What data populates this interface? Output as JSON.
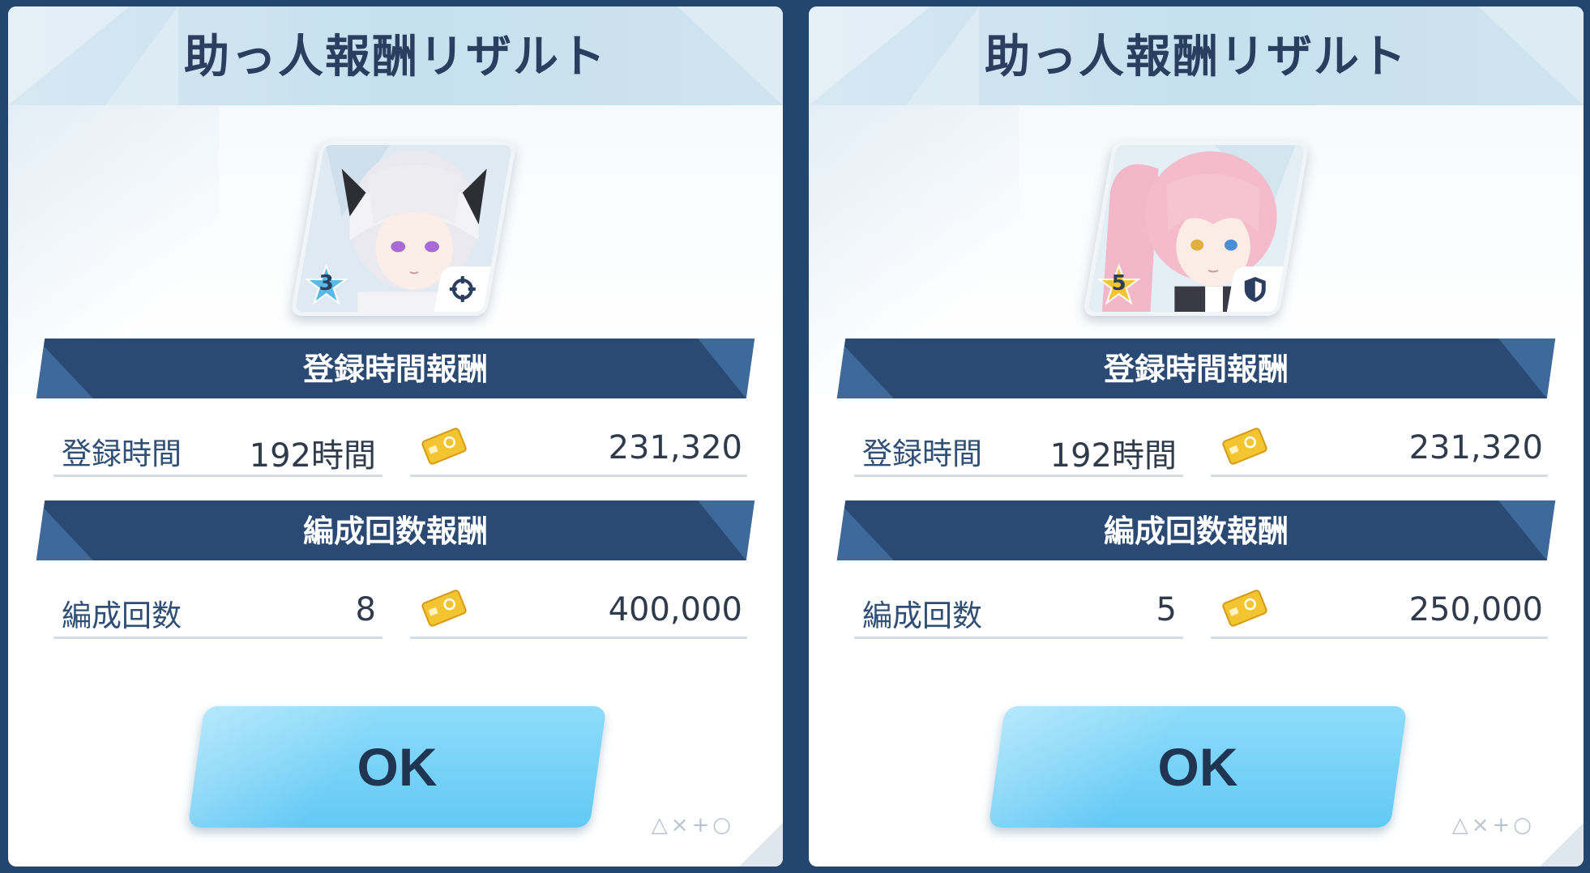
{
  "panels": [
    {
      "title": "助っ人報酬リザルト",
      "character": {
        "star_rank": "3",
        "star_color": "#5bb8e8",
        "role_icon": "crosshair-icon"
      },
      "registration": {
        "section_title": "登録時間報酬",
        "label": "登録時間",
        "value": "192時間",
        "reward_icon": "credit-card-icon",
        "reward": "231,320"
      },
      "formation": {
        "section_title": "編成回数報酬",
        "label": "編成回数",
        "value": "8",
        "reward_icon": "credit-card-icon",
        "reward": "400,000"
      },
      "ok_label": "OK",
      "controls": "△×+○"
    },
    {
      "title": "助っ人報酬リザルト",
      "character": {
        "star_rank": "5",
        "star_color": "#f2c531",
        "role_icon": "shield-icon"
      },
      "registration": {
        "section_title": "登録時間報酬",
        "label": "登録時間",
        "value": "192時間",
        "reward_icon": "credit-card-icon",
        "reward": "231,320"
      },
      "formation": {
        "section_title": "編成回数報酬",
        "label": "編成回数",
        "value": "5",
        "reward_icon": "credit-card-icon",
        "reward": "250,000"
      },
      "ok_label": "OK",
      "controls": "△×+○"
    }
  ],
  "colors": {
    "background": "#23466e",
    "section_bar": "#2b4a73",
    "ok_button": "#6fd0f7",
    "credit": "#f2c531"
  }
}
